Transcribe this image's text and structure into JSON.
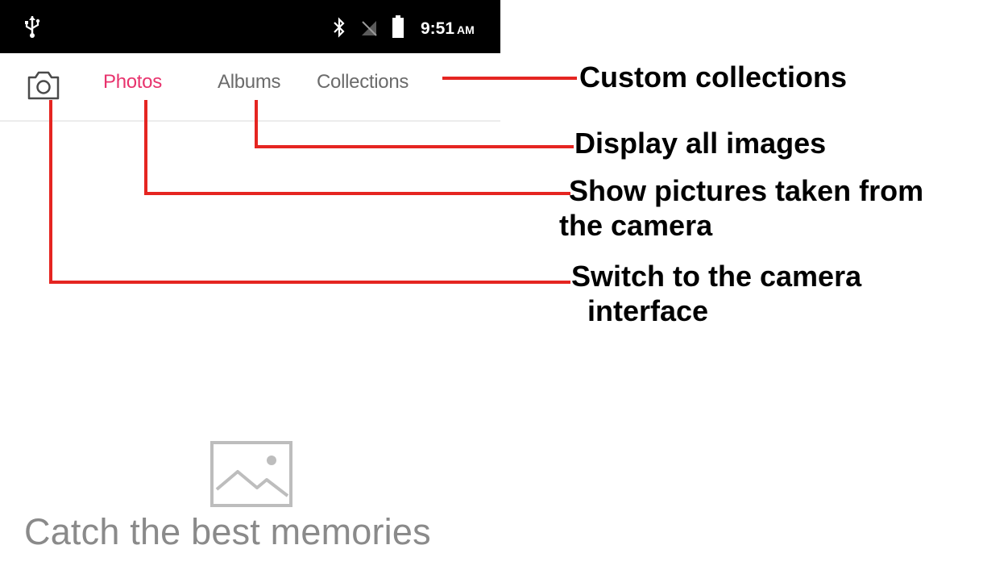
{
  "status_bar": {
    "usb_icon": "usb-icon",
    "bluetooth_icon": "bluetooth-icon",
    "signal_icon": "no-sim-icon",
    "battery_icon": "battery-icon",
    "time": "9:51",
    "ampm": "AM"
  },
  "tabs": {
    "camera_icon": "camera-icon",
    "items": [
      {
        "label": "Photos",
        "active": true
      },
      {
        "label": "Albums",
        "active": false
      },
      {
        "label": "Collections",
        "active": false
      }
    ]
  },
  "callouts": [
    {
      "lines": [
        "Custom collections"
      ]
    },
    {
      "lines": [
        "Display all images"
      ]
    },
    {
      "lines": [
        "Show pictures taken from",
        "the camera"
      ]
    },
    {
      "lines": [
        "Switch to the camera",
        "  interface"
      ]
    }
  ],
  "empty_state": {
    "icon": "image-placeholder-icon",
    "message": "Catch the best memories"
  },
  "colors": {
    "active_tab": "#e8336d",
    "inactive_tab": "#6b6b6b",
    "callout_line": "#e52521"
  }
}
